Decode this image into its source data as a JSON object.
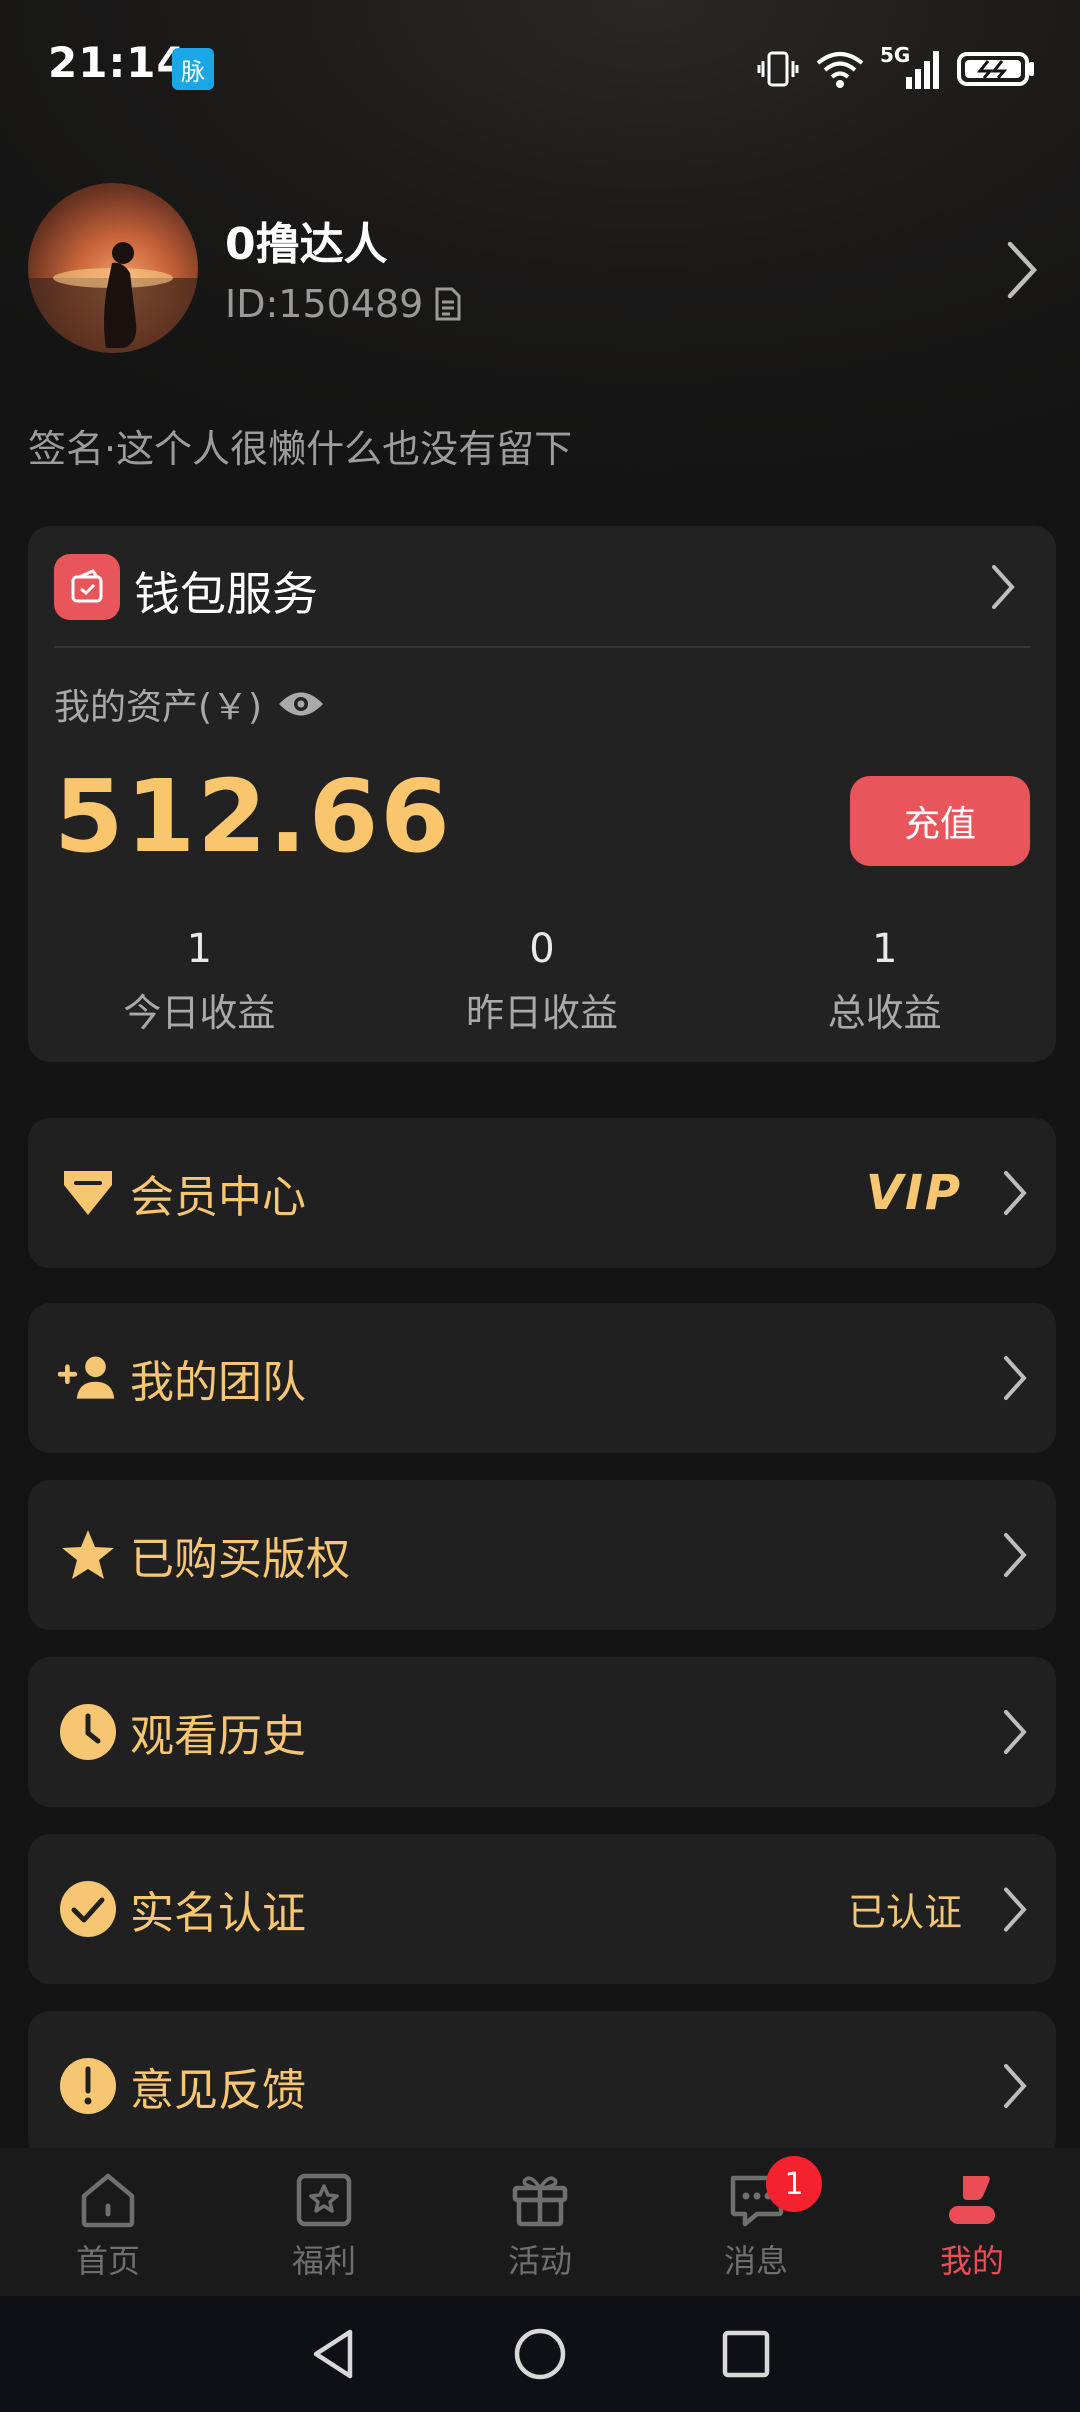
{
  "status_bar": {
    "time": "21:14",
    "app_icon_text": "脉",
    "network": "5G"
  },
  "profile": {
    "username": "0撸达人",
    "user_id": "ID:150489",
    "signature": "签名·这个人很懒什么也没有留下"
  },
  "wallet": {
    "title": "钱包服务",
    "asset_label": "我的资产(￥)",
    "asset_value": "512.66",
    "recharge_label": "充值",
    "stats": [
      {
        "value": "1",
        "label": "今日收益"
      },
      {
        "value": "0",
        "label": "昨日收益"
      },
      {
        "value": "1",
        "label": "总收益"
      }
    ]
  },
  "menu": {
    "items": [
      {
        "label": "会员中心",
        "extra": "VIP",
        "icon": "diamond-icon"
      },
      {
        "label": "我的团队",
        "extra": "",
        "icon": "add-person-icon"
      },
      {
        "label": "已购买版权",
        "extra": "",
        "icon": "star-icon"
      },
      {
        "label": "观看历史",
        "extra": "",
        "icon": "clock-icon"
      },
      {
        "label": "实名认证",
        "extra": "已认证",
        "icon": "check-circle-icon"
      },
      {
        "label": "意见反馈",
        "extra": "",
        "icon": "exclamation-icon"
      }
    ]
  },
  "bottom_nav": {
    "items": [
      {
        "label": "首页",
        "icon": "home-icon"
      },
      {
        "label": "福利",
        "icon": "welfare-icon"
      },
      {
        "label": "活动",
        "icon": "gift-icon"
      },
      {
        "label": "消息",
        "icon": "message-icon",
        "badge": "1"
      },
      {
        "label": "我的",
        "icon": "profile-icon",
        "active": true
      }
    ]
  },
  "colors": {
    "accent_gold": "#f7c673",
    "accent_red": "#e8565c",
    "background": "#141414",
    "card": "#222222"
  }
}
